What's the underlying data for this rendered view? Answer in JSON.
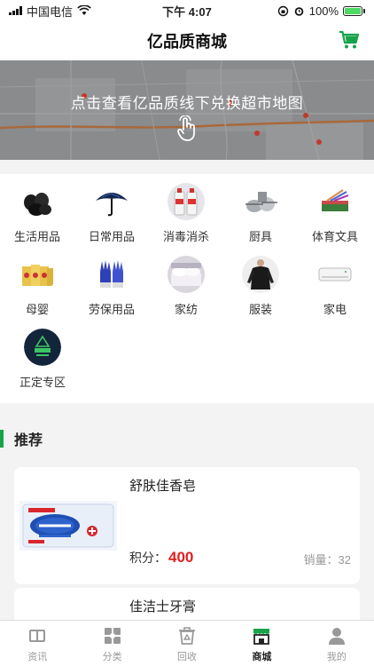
{
  "status": {
    "carrier": "中国电信",
    "time": "下午 4:07",
    "battery": "100%",
    "battery_level": 1.0
  },
  "nav": {
    "title": "亿品质商城"
  },
  "banner": {
    "text": "点击查看亿品质线下兑换超市地图"
  },
  "categories": [
    {
      "label": "生活用品",
      "icon": "trash-bags-icon"
    },
    {
      "label": "日常用品",
      "icon": "umbrella-icon"
    },
    {
      "label": "消毒消杀",
      "icon": "disinfectant-icon"
    },
    {
      "label": "厨具",
      "icon": "cookware-icon"
    },
    {
      "label": "体育文具",
      "icon": "stationery-icon"
    },
    {
      "label": "母婴",
      "icon": "baby-products-icon"
    },
    {
      "label": "劳保用品",
      "icon": "work-gloves-icon"
    },
    {
      "label": "家纺",
      "icon": "bedding-icon"
    },
    {
      "label": "服装",
      "icon": "clothing-icon"
    },
    {
      "label": "家电",
      "icon": "air-conditioner-icon"
    },
    {
      "label": "正定专区",
      "icon": "zhengding-logo-icon"
    }
  ],
  "section": {
    "title": "推荐"
  },
  "products": [
    {
      "name": "舒肤佳香皂",
      "points_label": "积分：",
      "points": "400",
      "sales_label": "销量：",
      "sales": "32"
    },
    {
      "name": "佳洁士牙膏"
    }
  ],
  "tabs": [
    {
      "label": "资讯",
      "icon": "news-icon"
    },
    {
      "label": "分类",
      "icon": "category-icon"
    },
    {
      "label": "回收",
      "icon": "recycle-icon"
    },
    {
      "label": "商城",
      "icon": "shop-icon",
      "active": true
    },
    {
      "label": "我的",
      "icon": "profile-icon"
    }
  ],
  "colors": {
    "accent": "#16a34a",
    "points": "#e02020"
  }
}
